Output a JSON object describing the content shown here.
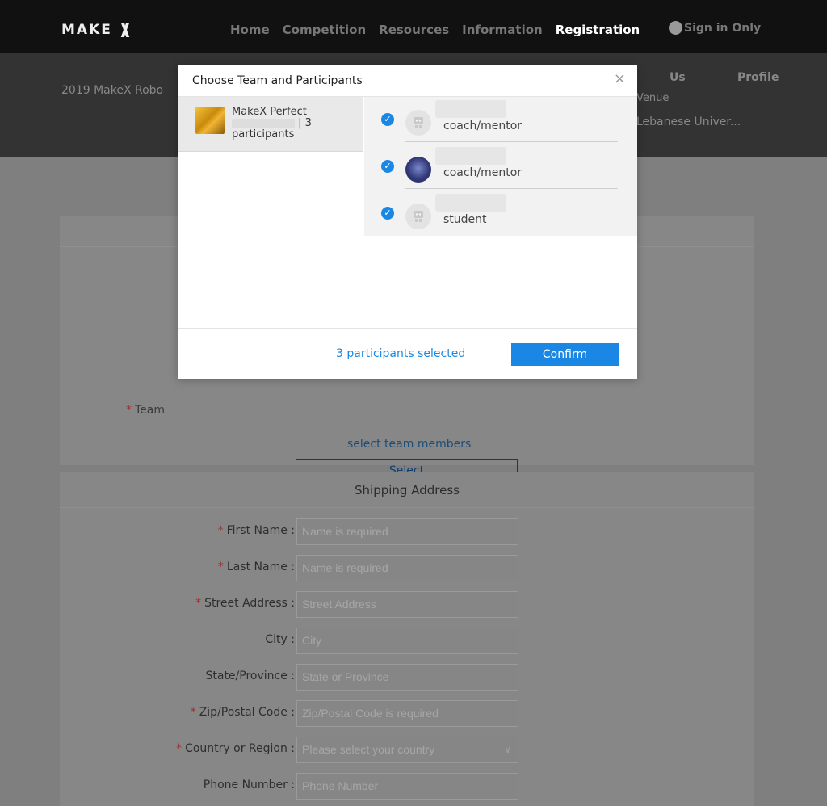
{
  "nav": {
    "logo": "MAKE",
    "links": [
      "Home",
      "Competition",
      "Resources",
      "Information",
      "Registration"
    ],
    "active": "Registration",
    "user": "Sign in Only"
  },
  "hero": {
    "title": "2019 MakeX Robo",
    "us": "Us",
    "profile": "Profile",
    "venue": "Venue",
    "university": "Lebanese Univer..."
  },
  "form": {
    "team_label": "Team",
    "select_hint": "select team members",
    "select_button": "Select",
    "shipping_title": "Shipping Address",
    "fields": [
      {
        "label": "First Name :",
        "placeholder": "Name is required",
        "required": true,
        "type": "input"
      },
      {
        "label": "Last Name :",
        "placeholder": "Name is required",
        "required": true,
        "type": "input"
      },
      {
        "label": "Street Address :",
        "placeholder": "Street Address",
        "required": true,
        "type": "input"
      },
      {
        "label": "City :",
        "placeholder": "City",
        "required": false,
        "type": "input"
      },
      {
        "label": "State/Province :",
        "placeholder": "State or Province",
        "required": false,
        "type": "input"
      },
      {
        "label": "Zip/Postal Code :",
        "placeholder": "Zip/Postal Code is required",
        "required": true,
        "type": "input"
      },
      {
        "label": "Country or Region :",
        "placeholder": "Please select your country",
        "required": true,
        "type": "select"
      },
      {
        "label": "Phone Number :",
        "placeholder": "Phone Number",
        "required": false,
        "type": "input"
      }
    ]
  },
  "modal": {
    "title": "Choose Team and Participants",
    "close": "×",
    "team": {
      "name_line1": "MakeX Perfect",
      "count": "| 3",
      "participants": "participants"
    },
    "members": [
      {
        "role": "coach/mentor",
        "avatar": "robot",
        "checked": true
      },
      {
        "role": "coach/mentor",
        "avatar": "photo",
        "checked": true
      },
      {
        "role": "student",
        "avatar": "robot",
        "checked": true
      }
    ],
    "check_glyph": "✓",
    "selected_count": "3 participants selected",
    "confirm": "Confirm"
  }
}
